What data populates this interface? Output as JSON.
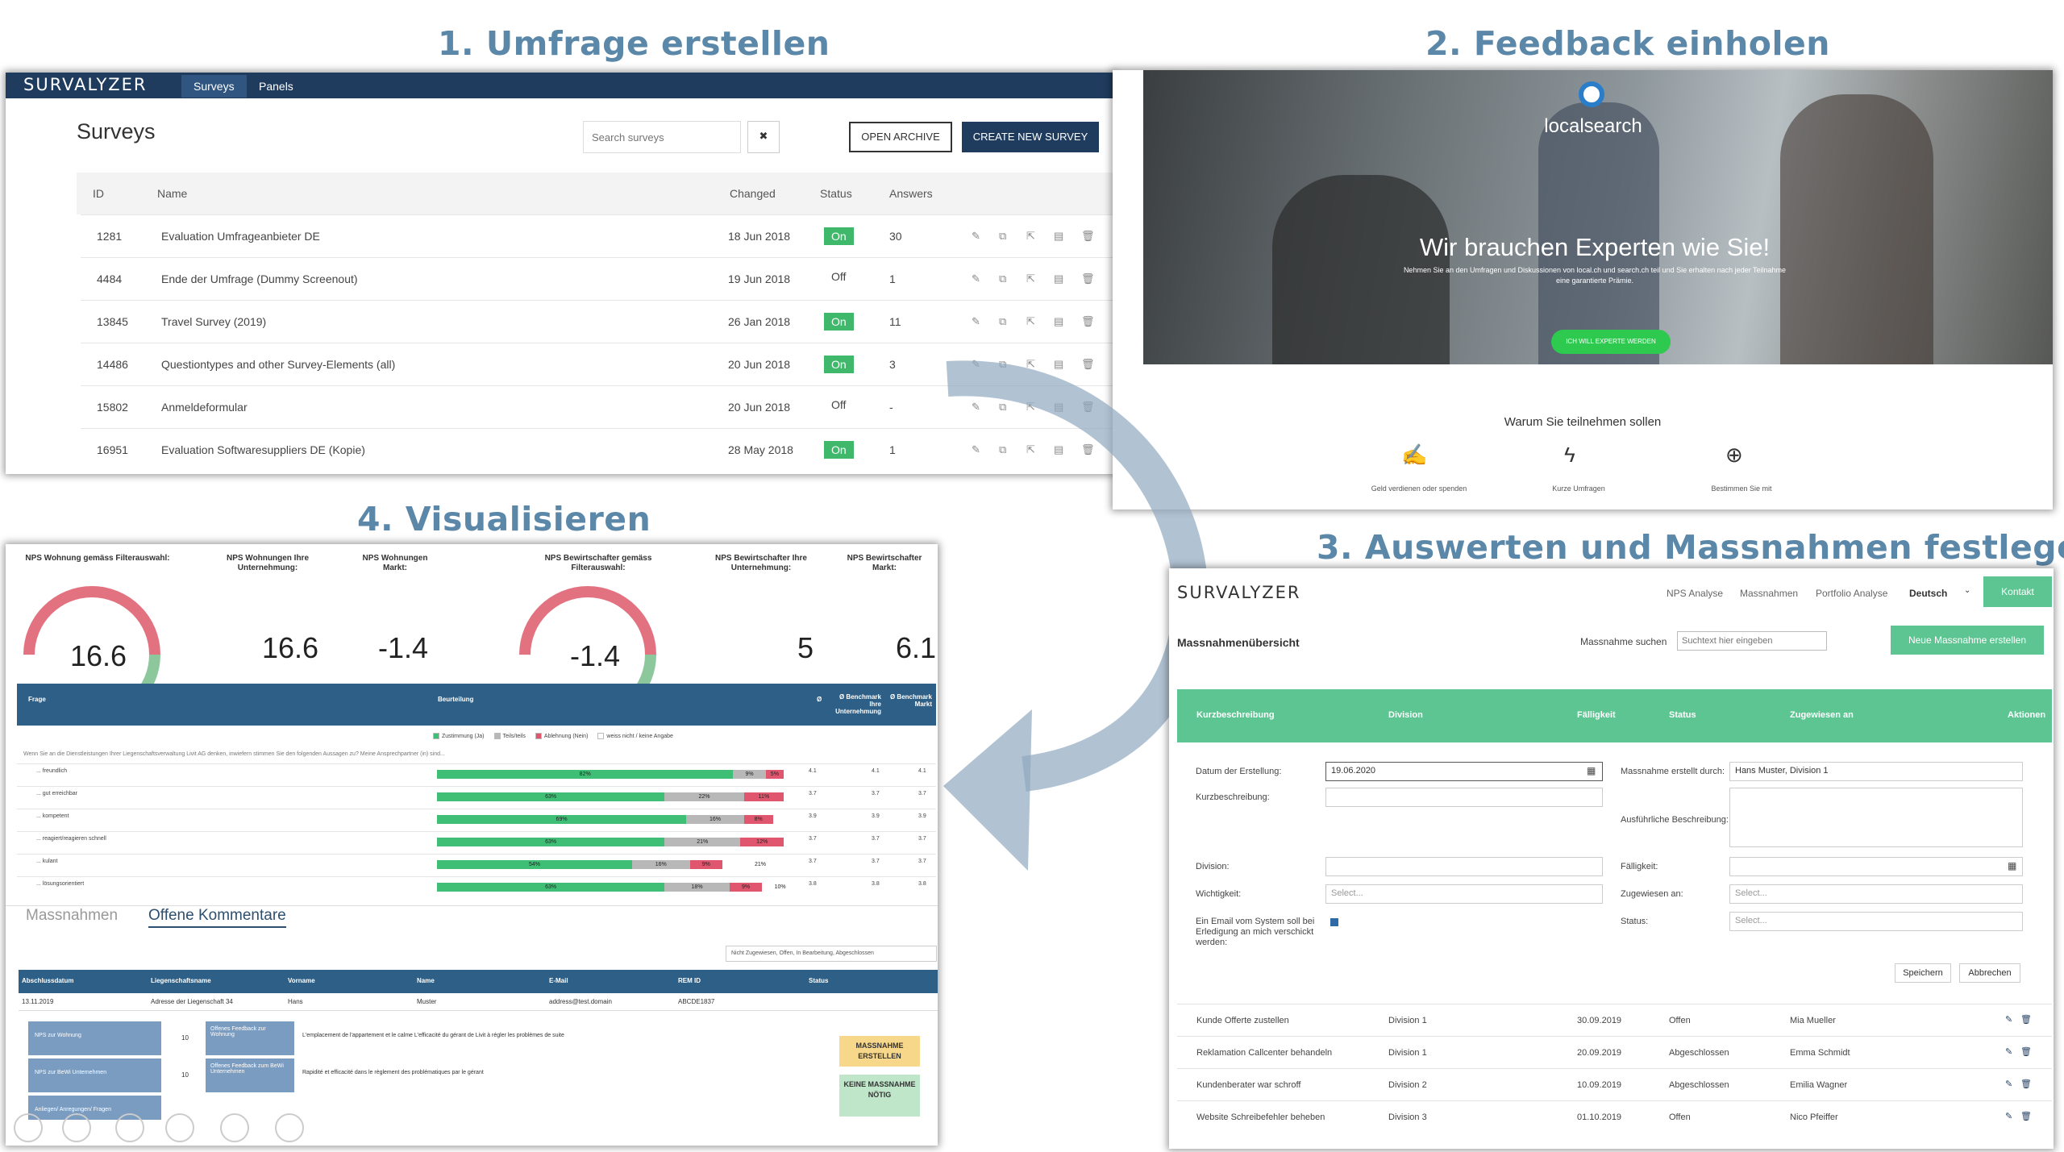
{
  "steps": {
    "s1": "1. Umfrage erstellen",
    "s2": "2. Feedback einholen",
    "s3": "3. Auswerten und Massnahmen festlegen",
    "s4": "4. Visualisieren"
  },
  "surveys_app": {
    "logo": "SURVALYZER",
    "nav": [
      "Surveys",
      "Panels"
    ],
    "title": "Surveys",
    "search_placeholder": "Search surveys",
    "clear": "✖",
    "open_archive": "OPEN ARCHIVE",
    "create_new": "CREATE NEW SURVEY",
    "columns": [
      "ID",
      "Name",
      "Changed",
      "Status",
      "Answers"
    ],
    "rows": [
      {
        "id": "1281",
        "name": "Evaluation Umfrageanbieter DE",
        "changed": "18 Jun 2018",
        "status": "On",
        "answers": "30"
      },
      {
        "id": "4484",
        "name": "Ende der Umfrage (Dummy Screenout)",
        "changed": "19 Jun 2018",
        "status": "Off",
        "answers": "1"
      },
      {
        "id": "13845",
        "name": "Travel Survey (2019)",
        "changed": "26 Jan 2018",
        "status": "On",
        "answers": "11"
      },
      {
        "id": "14486",
        "name": "Questiontypes and other Survey-Elements (all)",
        "changed": "20 Jun 2018",
        "status": "On",
        "answers": "3"
      },
      {
        "id": "15802",
        "name": "Anmeldeformular",
        "changed": "20 Jun 2018",
        "status": "Off",
        "answers": "-"
      },
      {
        "id": "16951",
        "name": "Evaluation Softwaresuppliers DE (Kopie)",
        "changed": "28 May 2018",
        "status": "On",
        "answers": "1"
      }
    ]
  },
  "feedback_page": {
    "brand": "localsearch",
    "headline": "Wir brauchen Experten wie Sie!",
    "subline1": "Nehmen Sie an den Umfragen und Diskussionen von local.ch und search.ch teil und Sie erhalten nach jeder Teilnahme",
    "subline2": "eine garantierte Prämie.",
    "cta": "ICH WILL EXPERTE WERDEN",
    "why": "Warum Sie teilnehmen sollen",
    "benefits": [
      "Geld verdienen oder spenden",
      "Kurze Umfragen",
      "Bestimmen Sie mit"
    ]
  },
  "actions_app": {
    "logo": "SURVALYZER",
    "nav": [
      "NPS Analyse",
      "Massnahmen",
      "Portfolio Analyse"
    ],
    "lang": "Deutsch",
    "contact": "Kontakt",
    "title": "Massnahmenübersicht",
    "search_label": "Massnahme suchen",
    "search_placeholder": "Suchtext hier eingeben",
    "new_btn": "Neue Massnahme erstellen",
    "columns": [
      "Kurzbeschreibung",
      "Division",
      "Fälligkeit",
      "Status",
      "Zugewiesen an",
      "Aktionen"
    ],
    "form": {
      "date_label": "Datum der Erstellung:",
      "date_value": "19.06.2020",
      "short_label": "Kurzbeschreibung:",
      "created_by_label": "Massnahme erstellt durch:",
      "created_by_value": "Hans Muster, Division 1",
      "long_label": "Ausführliche Beschreibung:",
      "division_label": "Division:",
      "due_label": "Fälligkeit:",
      "priority_label": "Wichtigkeit:",
      "assigned_label": "Zugewiesen an:",
      "select": "Select...",
      "email_label1": "Ein Email vom System soll bei",
      "email_label2": "Erledigung an mich verschickt",
      "email_label3": "werden:",
      "status_label": "Status:",
      "save": "Speichern",
      "cancel": "Abbrechen"
    },
    "rows": [
      {
        "desc": "Kunde Offerte zustellen",
        "division": "Division 1",
        "due": "30.09.2019",
        "status": "Offen",
        "assigned": "Mia Mueller"
      },
      {
        "desc": "Reklamation Callcenter behandeln",
        "division": "Division 1",
        "due": "20.09.2019",
        "status": "Abgeschlossen",
        "assigned": "Emma Schmidt"
      },
      {
        "desc": "Kundenberater war schroff",
        "division": "Division 2",
        "due": "10.09.2019",
        "status": "Abgeschlossen",
        "assigned": "Emilia Wagner"
      },
      {
        "desc": "Website Schreibefehler beheben",
        "division": "Division 3",
        "due": "01.10.2019",
        "status": "Offen",
        "assigned": "Nico Pfeiffer"
      }
    ]
  },
  "dashboard": {
    "kpis": [
      {
        "label": "NPS Wohnung gemäss Filterauswahl:",
        "value": "16.6"
      },
      {
        "label": "NPS Wohnungen Ihre Unternehmung:",
        "value": "16.6"
      },
      {
        "label": "NPS Wohnungen Markt:",
        "value": "-1.4"
      },
      {
        "label": "NPS Bewirtschafter gemäss Filterauswahl:",
        "value": "-1.4"
      },
      {
        "label": "NPS Bewirtschafter Ihre Unternehmung:",
        "value": "5"
      },
      {
        "label": "NPS Bewirtschafter Markt:",
        "value": "6.1"
      }
    ],
    "table_head": [
      "Frage",
      "Beurteilung",
      "Ø",
      "Ø Benchmark Ihre Unternehmung",
      "Ø Benchmark Markt"
    ],
    "legend": [
      "Zustimmung (Ja)",
      "Teils/teils",
      "Ablehnung (Nein)",
      "weiss nicht / keine Angabe"
    ],
    "question": "Wenn Sie an die Dienstleistungen Ihrer Liegenschaftsverwaltung Livit AG denken, inwiefern stimmen Sie den folgenden Aussagen zu? Meine Ansprechpartner (in) sind...",
    "items": [
      {
        "label": "... freundlich",
        "yes": 82,
        "part": 9,
        "no": 5,
        "avg": "4.1",
        "b1": "4.1",
        "b2": "4.1"
      },
      {
        "label": "... gut erreichbar",
        "yes": 63,
        "part": 22,
        "no": 11,
        "avg": "3.7",
        "b1": "3.7",
        "b2": "3.7"
      },
      {
        "label": "... kompetent",
        "yes": 69,
        "part": 16,
        "no": 8,
        "avg": "3.9",
        "b1": "3.9",
        "b2": "3.9"
      },
      {
        "label": "... reagiert/reagieren schnell",
        "yes": 63,
        "part": 21,
        "no": 12,
        "avg": "3.7",
        "b1": "3.7",
        "b2": "3.7"
      },
      {
        "label": "... kulant",
        "yes": 54,
        "part": 16,
        "no": 9,
        "none": 21,
        "avg": "3.7",
        "b1": "3.7",
        "b2": "3.7"
      },
      {
        "label": "... lösungsorientiert",
        "yes": 63,
        "part": 18,
        "no": 9,
        "none": 10,
        "avg": "3.8",
        "b1": "3.8",
        "b2": "3.8"
      }
    ],
    "tabs": [
      "Massnahmen",
      "Offene Kommentare"
    ],
    "filter": "Nicht Zugewiesen, Offen, In Bearbeitung, Abgeschlossen",
    "comment_cols": [
      "Abschlussdatum",
      "Liegenschaftsname",
      "Vorname",
      "Name",
      "E-Mail",
      "REM ID",
      "Status"
    ],
    "comment_row": {
      "date": "13.11.2019",
      "property": "Adresse der Liegenschaft 34",
      "first": "Hans",
      "last": "Muster",
      "email": "address@test.domain",
      "rem": "ABCDE1837"
    },
    "groups": [
      {
        "label": "NPS zur Wohnung",
        "n": "10",
        "type": "Offenes Feedback zur Wohnung",
        "text": "L'emplacement de l'appartement et le calme L'efficacité du gérant de Livit à régler les problèmes de suite"
      },
      {
        "label": "NPS zur BeWi Unternehmen",
        "n": "10",
        "type": "Offenes Feedback zum BeWi Unternehmen",
        "text": "Rapidité et efficacité dans le règlement des problématiques par le gérant"
      },
      {
        "label": "Anliegen/ Anregungen/ Fragen",
        "n": "",
        "type": "",
        "text": ""
      }
    ],
    "btn_create": "MASSNAHME ERSTELLEN",
    "btn_none": "KEINE MASSNAHME NÖTIG",
    "colors": {
      "yes": "#3fbf76",
      "part": "#b8b8b8",
      "no": "#e0566e",
      "none": "#ffffff",
      "header": "#2e5f86"
    }
  }
}
